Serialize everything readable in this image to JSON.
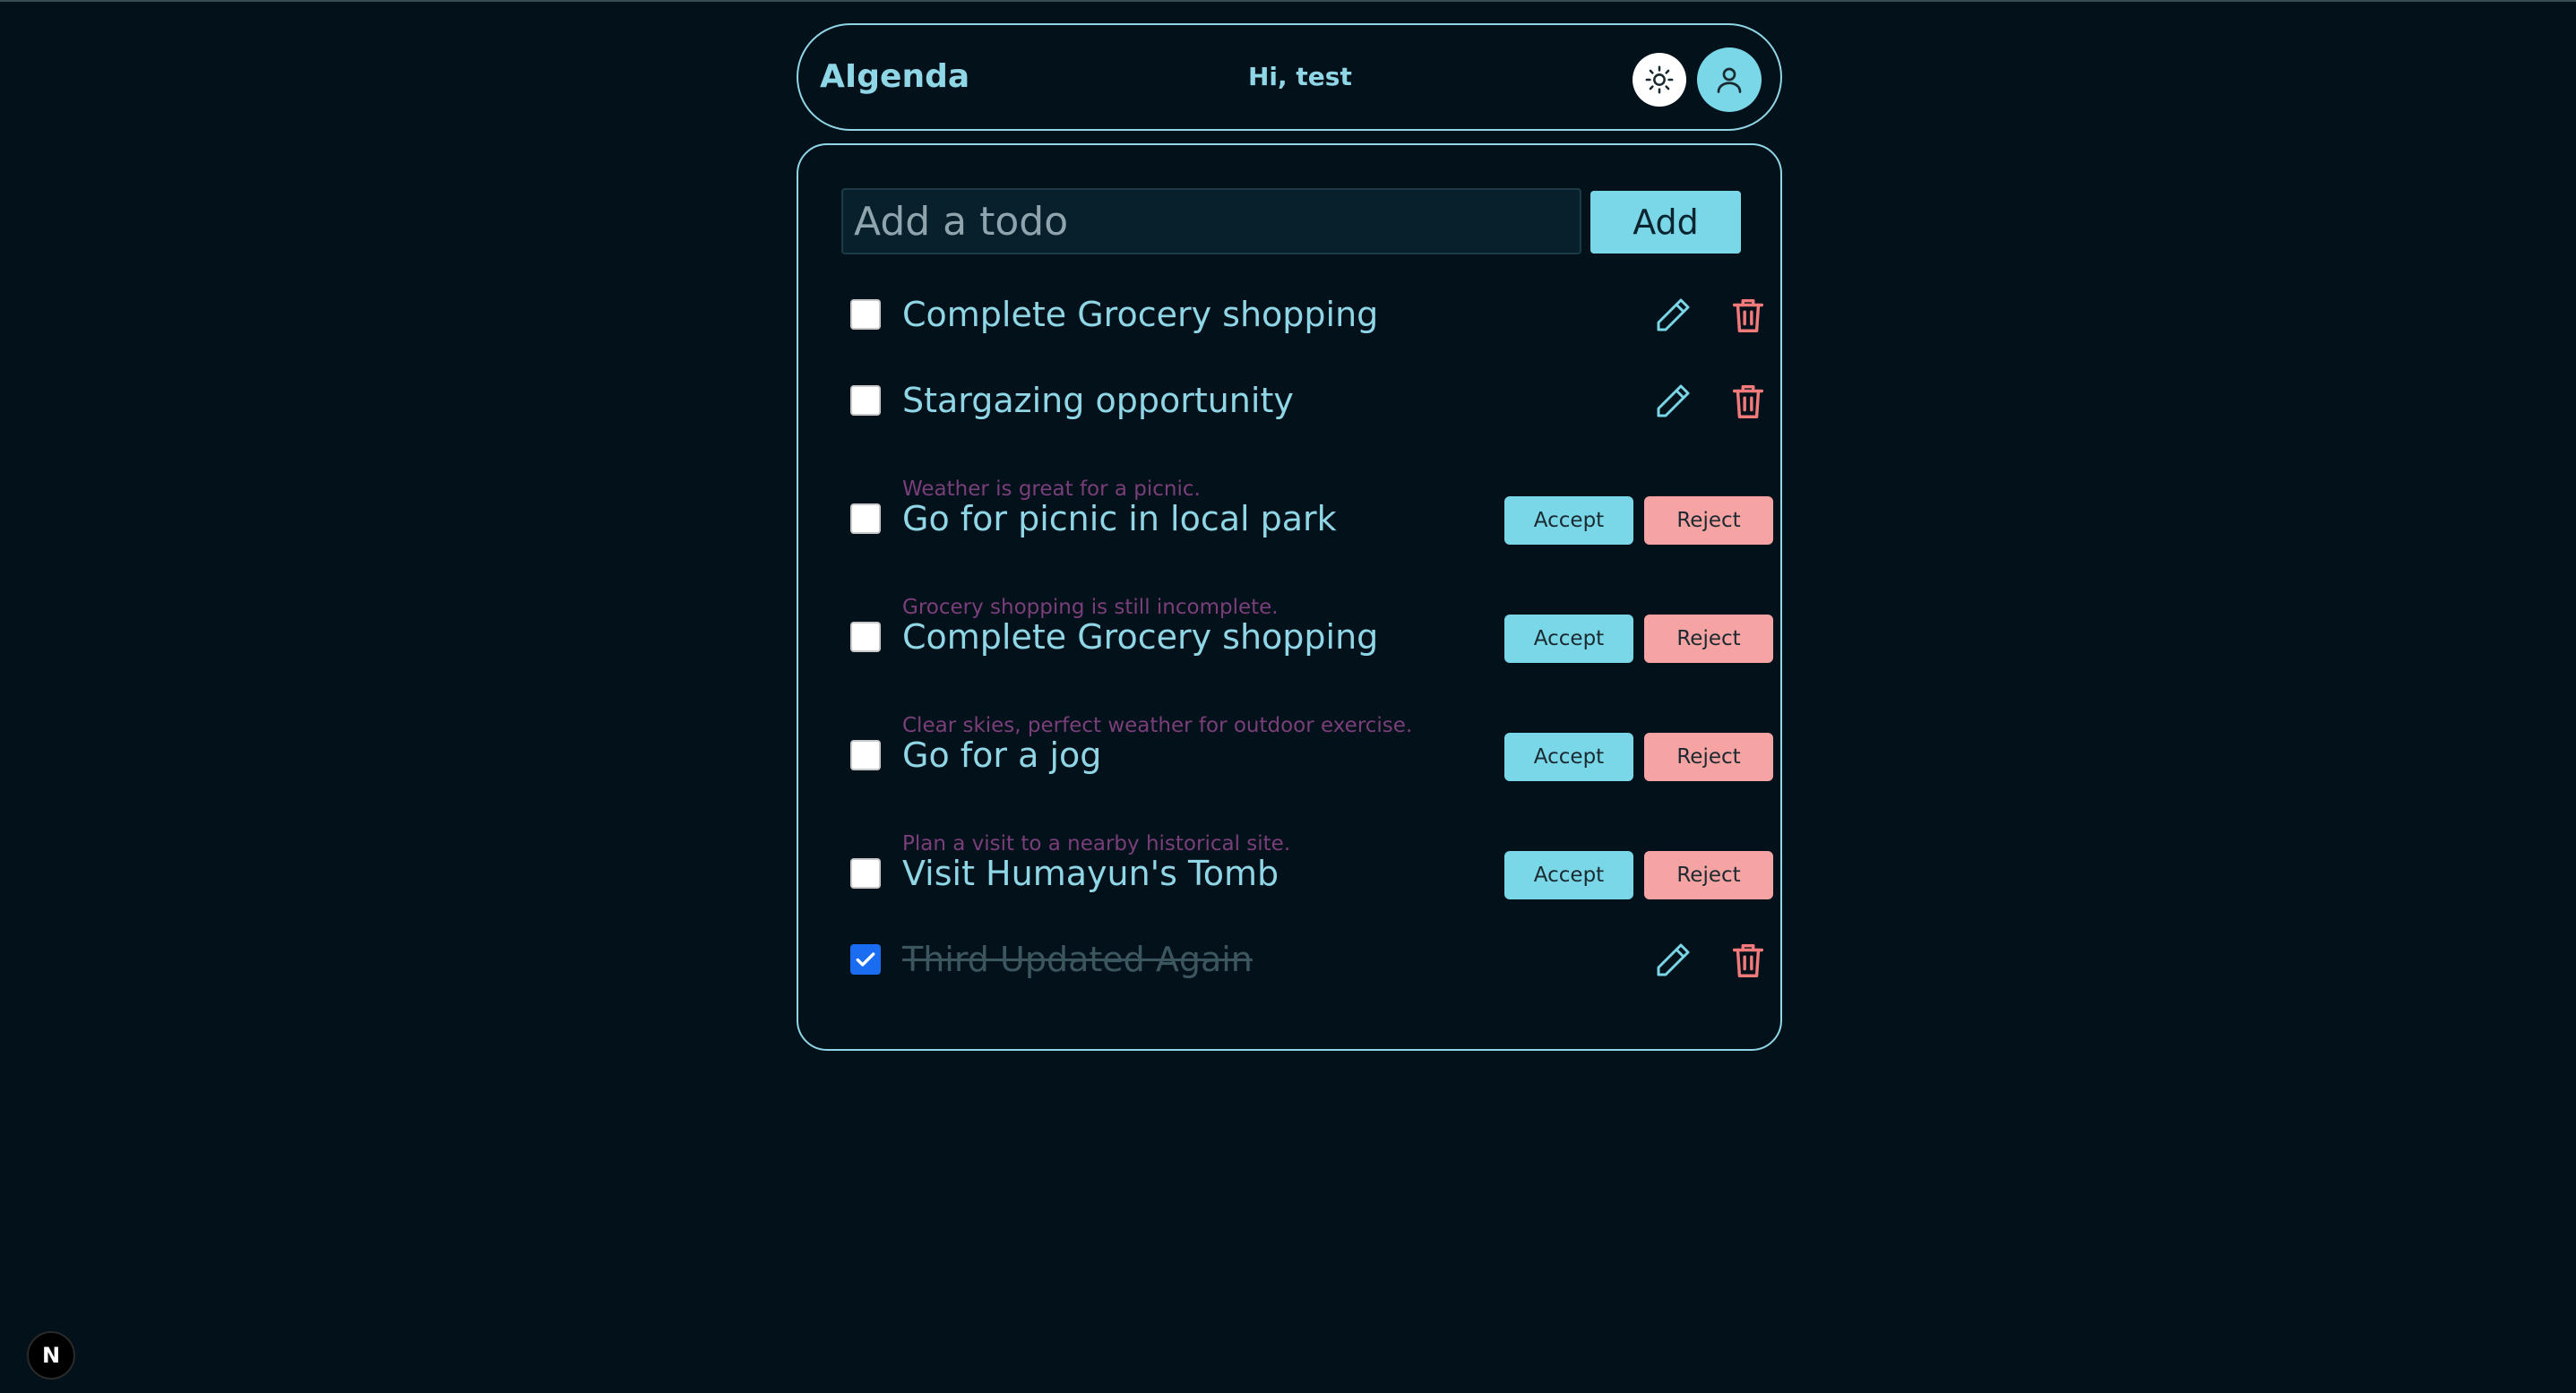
{
  "header": {
    "brand": "AIgenda",
    "greeting": "Hi, test",
    "theme_icon": "sun-icon",
    "user_icon": "user-icon"
  },
  "composer": {
    "placeholder": "Add a todo",
    "value": "",
    "add_label": "Add"
  },
  "todos": [
    {
      "text": "Complete Grocery shopping",
      "checked": false,
      "type": "todo"
    },
    {
      "text": "Stargazing opportunity",
      "checked": false,
      "type": "todo"
    },
    {
      "text": "Go for picnic in local park",
      "reason": "Weather is great for a picnic.",
      "checked": false,
      "type": "suggestion"
    },
    {
      "text": "Complete Grocery shopping",
      "reason": "Grocery shopping is still incomplete.",
      "checked": false,
      "type": "suggestion"
    },
    {
      "text": "Go for a jog",
      "reason": "Clear skies, perfect weather for outdoor exercise.",
      "checked": false,
      "type": "suggestion"
    },
    {
      "text": "Visit Humayun's Tomb",
      "reason": "Plan a visit to a nearby historical site.",
      "checked": false,
      "type": "suggestion"
    },
    {
      "text": "Third Updated Again",
      "checked": true,
      "type": "todo"
    }
  ],
  "actions": {
    "accept_label": "Accept",
    "reject_label": "Reject"
  },
  "colors": {
    "background": "#03111a",
    "accent": "#79d7e8",
    "delete": "#f27a7a",
    "reject": "#f5a3a3",
    "reason_text": "#7a3f7a",
    "checked": "#1a6cf0"
  },
  "badge": {
    "label": "N"
  }
}
